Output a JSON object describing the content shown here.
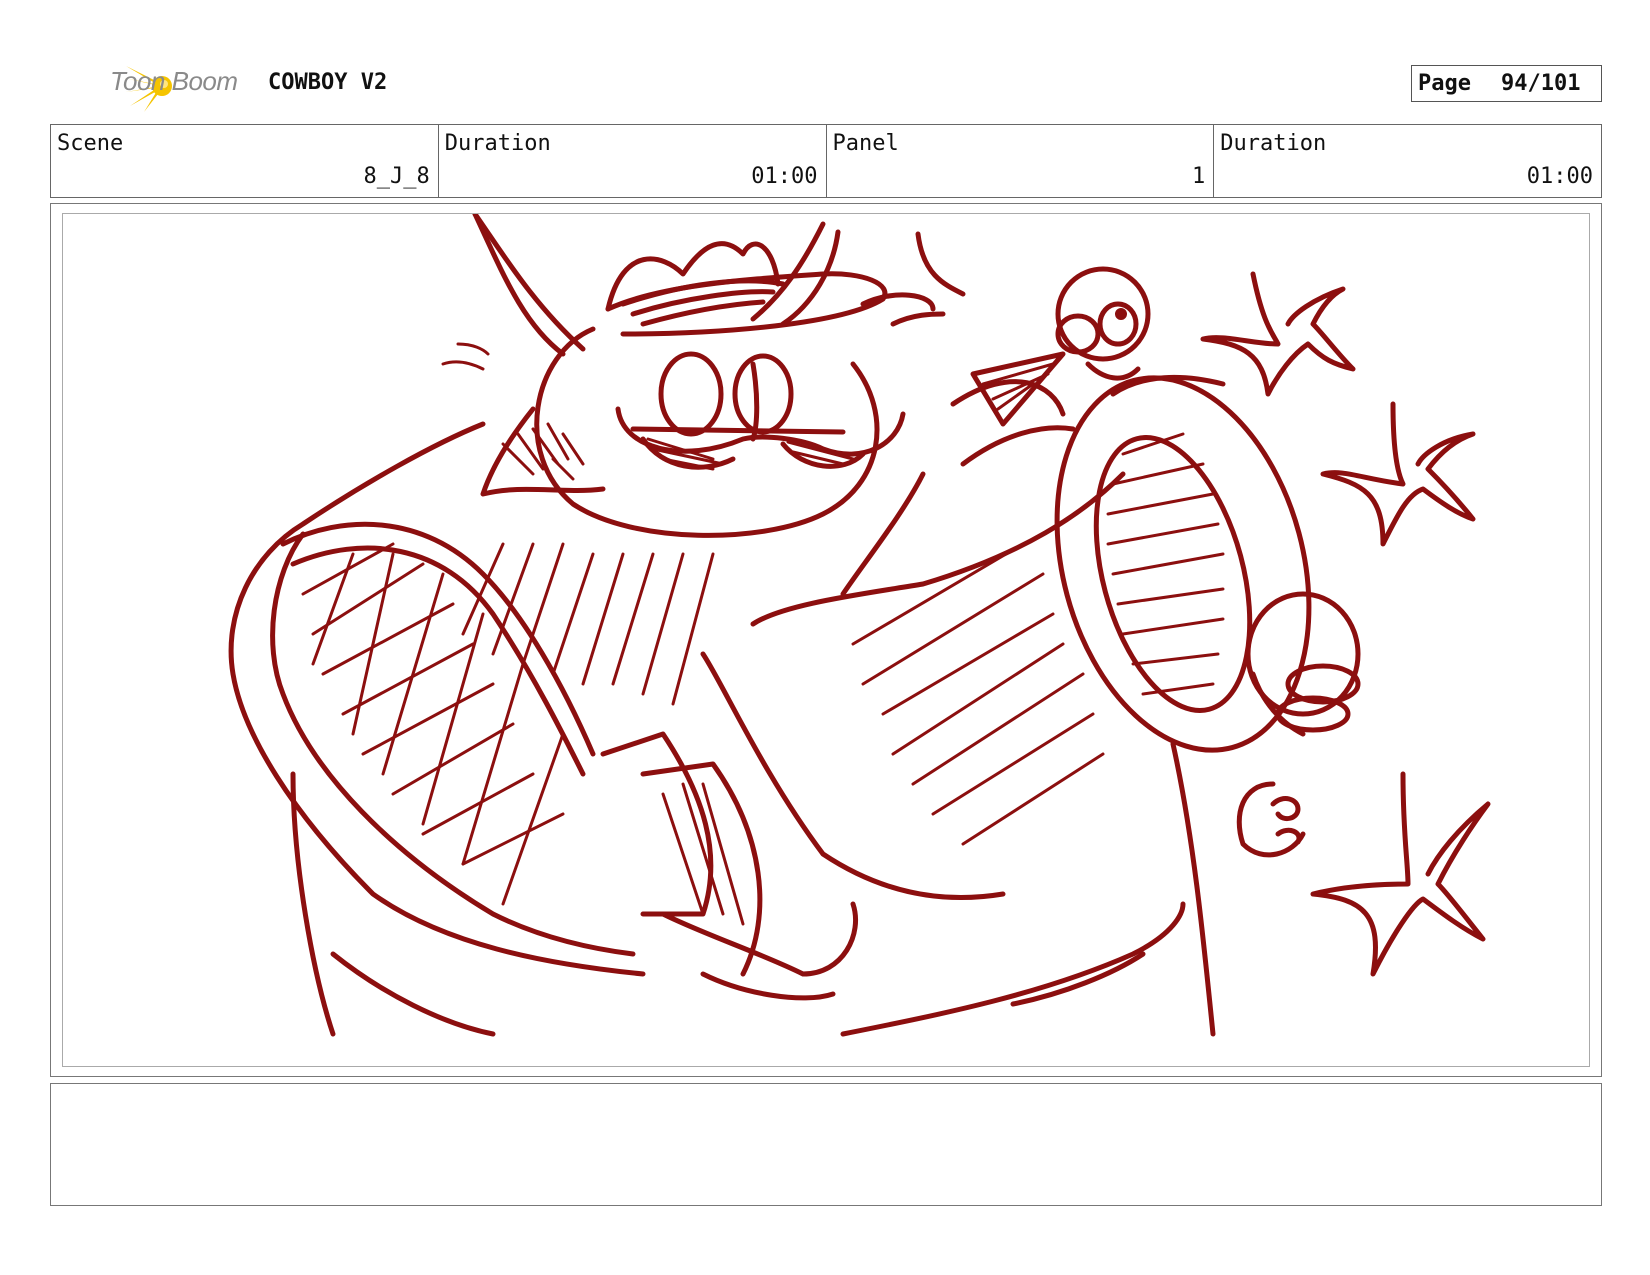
{
  "header": {
    "logo_text": "Toon Boom",
    "project_title": "COWBOY V2",
    "page_label": "Page",
    "page_number": "94/101"
  },
  "info": {
    "scene_label": "Scene",
    "scene_value": "8_J_8",
    "scene_duration_label": "Duration",
    "scene_duration_value": "01:00",
    "panel_label": "Panel",
    "panel_value": "1",
    "panel_duration_label": "Duration",
    "panel_duration_value": "01:00"
  },
  "colors": {
    "sketch": "#8c0f0f",
    "logo_yellow": "#f5c400",
    "logo_text": "#8a8a8a"
  },
  "notes": {
    "text": ""
  }
}
